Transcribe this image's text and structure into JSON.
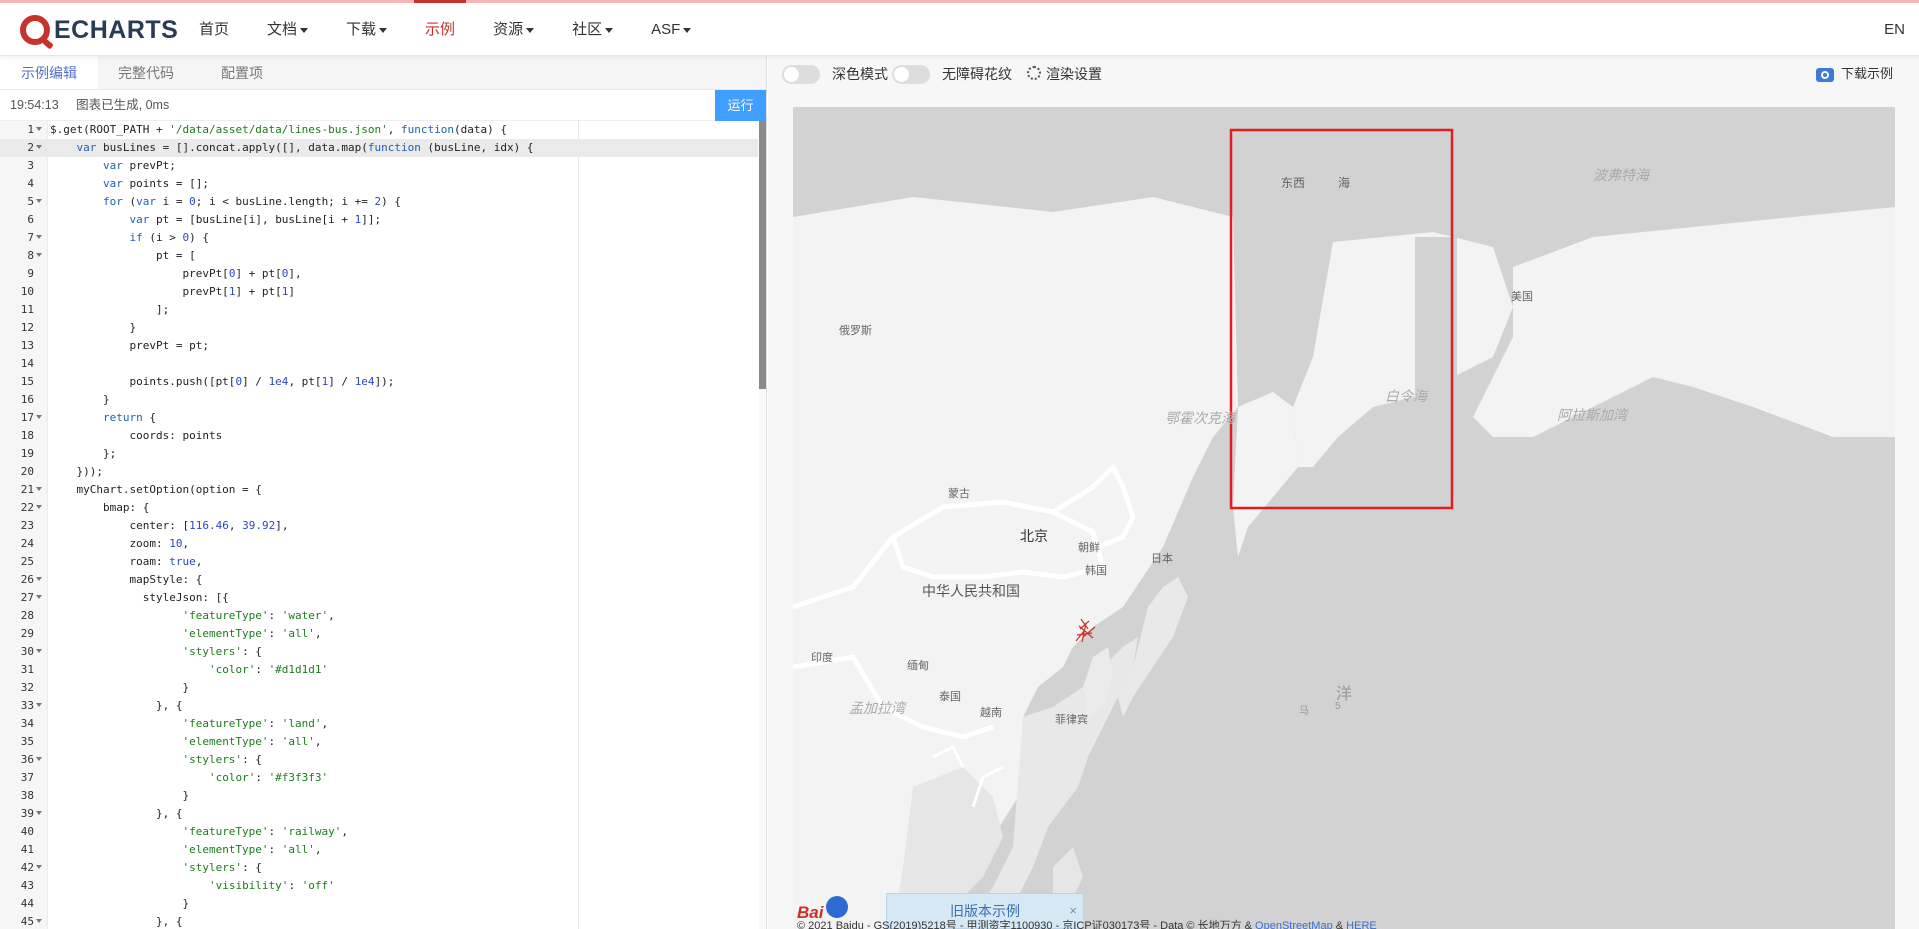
{
  "nav": {
    "logo_text": "ECHARTS",
    "items": [
      {
        "label": "首页",
        "dropdown": false,
        "active": false
      },
      {
        "label": "文档",
        "dropdown": true,
        "active": false
      },
      {
        "label": "下载",
        "dropdown": true,
        "active": false
      },
      {
        "label": "示例",
        "dropdown": false,
        "active": true
      },
      {
        "label": "资源",
        "dropdown": true,
        "active": false
      },
      {
        "label": "社区",
        "dropdown": true,
        "active": false
      },
      {
        "label": "ASF",
        "dropdown": true,
        "active": false
      }
    ],
    "lang": "EN"
  },
  "editor": {
    "tabs": [
      "示例编辑",
      "完整代码",
      "配置项"
    ],
    "active_tab": 0,
    "status_time": "19:54:13",
    "status_text": "图表已生成, 0ms",
    "run_label": "运行",
    "highlight_line": 2,
    "lines": [
      {
        "n": "1",
        "fold": true,
        "code": "$.get(ROOT_PATH + '/data/asset/data/lines-bus.json', function(data) {"
      },
      {
        "n": "2",
        "fold": true,
        "code": "    var busLines = [].concat.apply([], data.map(function (busLine, idx) {"
      },
      {
        "n": "3",
        "fold": false,
        "code": "        var prevPt;"
      },
      {
        "n": "4",
        "fold": false,
        "code": "        var points = [];"
      },
      {
        "n": "5",
        "fold": true,
        "code": "        for (var i = 0; i < busLine.length; i += 2) {"
      },
      {
        "n": "6",
        "fold": false,
        "code": "            var pt = [busLine[i], busLine[i + 1]];"
      },
      {
        "n": "7",
        "fold": true,
        "code": "            if (i > 0) {"
      },
      {
        "n": "8",
        "fold": true,
        "code": "                pt = ["
      },
      {
        "n": "9",
        "fold": false,
        "code": "                    prevPt[0] + pt[0],"
      },
      {
        "n": "10",
        "fold": false,
        "code": "                    prevPt[1] + pt[1]"
      },
      {
        "n": "11",
        "fold": false,
        "code": "                ];"
      },
      {
        "n": "12",
        "fold": false,
        "code": "            }"
      },
      {
        "n": "13",
        "fold": false,
        "code": "            prevPt = pt;"
      },
      {
        "n": "14",
        "fold": false,
        "code": ""
      },
      {
        "n": "15",
        "fold": false,
        "code": "            points.push([pt[0] / 1e4, pt[1] / 1e4]);"
      },
      {
        "n": "16",
        "fold": false,
        "code": "        }"
      },
      {
        "n": "17",
        "fold": true,
        "code": "        return {"
      },
      {
        "n": "18",
        "fold": false,
        "code": "            coords: points"
      },
      {
        "n": "19",
        "fold": false,
        "code": "        };"
      },
      {
        "n": "20",
        "fold": false,
        "code": "    }));"
      },
      {
        "n": "21",
        "fold": true,
        "code": "    myChart.setOption(option = {"
      },
      {
        "n": "22",
        "fold": true,
        "code": "        bmap: {"
      },
      {
        "n": "23",
        "fold": false,
        "code": "            center: [116.46, 39.92],"
      },
      {
        "n": "24",
        "fold": false,
        "code": "            zoom: 10,"
      },
      {
        "n": "25",
        "fold": false,
        "code": "            roam: true,"
      },
      {
        "n": "26",
        "fold": true,
        "code": "            mapStyle: {"
      },
      {
        "n": "27",
        "fold": true,
        "code": "              styleJson: [{"
      },
      {
        "n": "28",
        "fold": false,
        "code": "                    'featureType': 'water',"
      },
      {
        "n": "29",
        "fold": false,
        "code": "                    'elementType': 'all',"
      },
      {
        "n": "30",
        "fold": true,
        "code": "                    'stylers': {"
      },
      {
        "n": "31",
        "fold": false,
        "code": "                        'color': '#d1d1d1'"
      },
      {
        "n": "32",
        "fold": false,
        "code": "                    }"
      },
      {
        "n": "33",
        "fold": true,
        "code": "                }, {"
      },
      {
        "n": "34",
        "fold": false,
        "code": "                    'featureType': 'land',"
      },
      {
        "n": "35",
        "fold": false,
        "code": "                    'elementType': 'all',"
      },
      {
        "n": "36",
        "fold": true,
        "code": "                    'stylers': {"
      },
      {
        "n": "37",
        "fold": false,
        "code": "                        'color': '#f3f3f3'"
      },
      {
        "n": "38",
        "fold": false,
        "code": "                    }"
      },
      {
        "n": "39",
        "fold": true,
        "code": "                }, {"
      },
      {
        "n": "40",
        "fold": false,
        "code": "                    'featureType': 'railway',"
      },
      {
        "n": "41",
        "fold": false,
        "code": "                    'elementType': 'all',"
      },
      {
        "n": "42",
        "fold": true,
        "code": "                    'stylers': {"
      },
      {
        "n": "43",
        "fold": false,
        "code": "                        'visibility': 'off'"
      },
      {
        "n": "44",
        "fold": false,
        "code": "                    }"
      },
      {
        "n": "45",
        "fold": true,
        "code": "                }, {"
      }
    ]
  },
  "preview": {
    "dark_mode_label": "深色模式",
    "decal_label": "无障碍花纹",
    "render_label": "渲染设置",
    "download_label": "下载示例",
    "old_version_label": "旧版本示例",
    "old_version_close": "×",
    "baidu_logo": "Bai",
    "copyright": "© 2021 Baidu - GS(2019)5218号 - 甲测资字1100930 - 京ICP证030173号 - Data © 长地万方 &",
    "copyright_link1": "OpenStreetMap",
    "copyright_amp": "&",
    "copyright_link2": "HERE",
    "map_labels": {
      "east_sea": "东西",
      "east_sea_2": "海",
      "beaufort": "波弗特海",
      "usa": "美国",
      "russia": "俄罗斯",
      "bering": "白令海",
      "okhotsk": "鄂霍次克海",
      "alaska": "阿拉斯加湾",
      "mongolia": "蒙古",
      "beijing": "北京",
      "dprk": "朝鲜",
      "rok": "韩国",
      "japan": "日本",
      "china": "中华人民共和国",
      "india": "印度",
      "myanmar": "缅甸",
      "thailand": "泰国",
      "bengal": "孟加拉湾",
      "vietnam": "越南",
      "philippines": "菲律宾",
      "ocean": "洋",
      "ocean_2": "马",
      "ocean_3": "5"
    },
    "colors": {
      "water": "#d2d2d2",
      "land": "#f3f3f3",
      "selection": "#e02020",
      "bus_lines": "#c4342c"
    }
  }
}
